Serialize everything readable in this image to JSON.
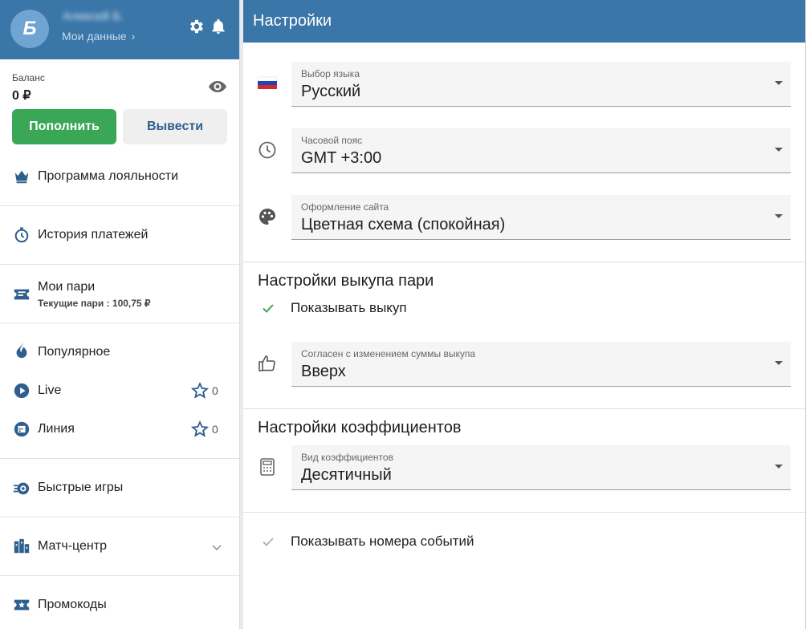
{
  "user": {
    "avatar_letter": "Б",
    "name": "Алексей Б.",
    "my_data": "Мои данные"
  },
  "balance": {
    "label": "Баланс",
    "value": "0 ₽"
  },
  "buttons": {
    "topup": "Пополнить",
    "withdraw": "Вывести"
  },
  "menu": {
    "loyalty": "Программа лояльности",
    "payments": "История платежей",
    "my_bets": "Мои пари",
    "my_bets_sub": "Текущие пари : 100,75 ₽",
    "popular": "Популярное",
    "live": "Live",
    "live_count": "0",
    "line": "Линия",
    "line_count": "0",
    "fast_games": "Быстрые игры",
    "match_center": "Матч-центр",
    "promo": "Промокоды"
  },
  "settings": {
    "title": "Настройки",
    "language": {
      "label": "Выбор языка",
      "value": "Русский"
    },
    "timezone": {
      "label": "Часовой пояс",
      "value": "GMT +3:00"
    },
    "theme": {
      "label": "Оформление сайта",
      "value": "Цветная схема (спокойная)"
    },
    "cashout_section": "Настройки выкупа пари",
    "show_cashout": "Показывать выкуп",
    "cashout_change": {
      "label": "Согласен с изменением суммы выкупа",
      "value": "Вверх"
    },
    "odds_section": "Настройки коэффициентов",
    "odds_type": {
      "label": "Вид коэффициентов",
      "value": "Десятичный"
    },
    "show_event_numbers": "Показывать номера событий"
  },
  "colors": {
    "header": "#3a76a8",
    "topup_green": "#3aa757",
    "check_green": "#3aa757",
    "icon_blue": "#2e5f8e"
  }
}
